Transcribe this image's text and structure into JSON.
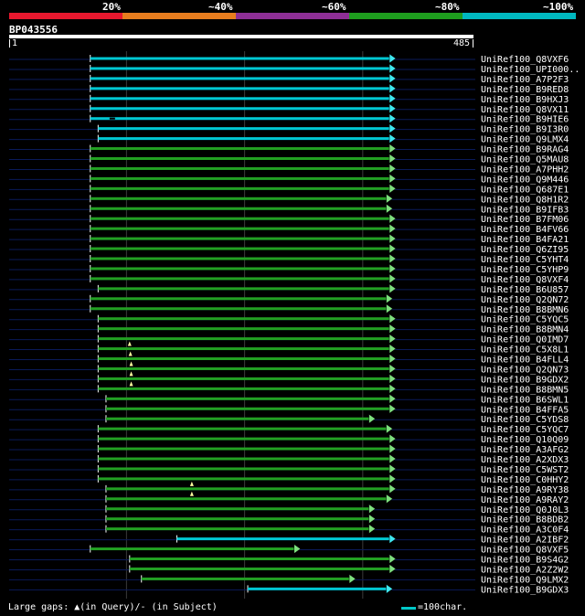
{
  "identity_legend": [
    {
      "label": "20%",
      "color": "#e8182e"
    },
    {
      "label": "~40%",
      "color": "#e87d1e"
    },
    {
      "label": "~60%",
      "color": "#8e2f96"
    },
    {
      "label": "~80%",
      "color": "#1e9e1e"
    },
    {
      "label": "~100%",
      "color": "#00b8c0"
    }
  ],
  "query": {
    "name": "BP043556",
    "start": "1",
    "end": "485",
    "length": 485
  },
  "colors": {
    "cyan": "#00c8d2",
    "green": "#22a022",
    "arrow_green": "#7ee07e",
    "arrow_cyan": "#3fe8f0",
    "gridline": "#3a3a3a",
    "rowline": "#0a1a5a"
  },
  "footer": {
    "gaps_text": "Large gaps: ▲(in Query)/- (in Subject)",
    "scale_text": "=100char."
  },
  "chart_data": {
    "type": "alignment-overview",
    "x_unit": "query residue position",
    "xlim": [
      1,
      485
    ],
    "gridlines_at": [
      150,
      300,
      450
    ],
    "hits": [
      {
        "name": "UniRef100_Q8VXF6",
        "start": 104,
        "end": 485,
        "identity": "~100%"
      },
      {
        "name": "UniRef100_UPI000..",
        "start": 104,
        "end": 485,
        "identity": "~100%"
      },
      {
        "name": "UniRef100_A7P2F3",
        "start": 104,
        "end": 485,
        "identity": "~100%"
      },
      {
        "name": "UniRef100_B9RED8",
        "start": 104,
        "end": 485,
        "identity": "~100%"
      },
      {
        "name": "UniRef100_B9HXJ3",
        "start": 104,
        "end": 485,
        "identity": "~100%"
      },
      {
        "name": "UniRef100_Q8VX11",
        "start": 104,
        "end": 485,
        "identity": "~100%"
      },
      {
        "name": "UniRef100_B9HIE6",
        "start": 104,
        "end": 485,
        "identity": "~100%",
        "subject_gap_at": 132
      },
      {
        "name": "UniRef100_B9I3R0",
        "start": 114,
        "end": 485,
        "identity": "~100%"
      },
      {
        "name": "UniRef100_Q9LMX4",
        "start": 114,
        "end": 485,
        "identity": "~100%"
      },
      {
        "name": "UniRef100_B9RAG4",
        "start": 104,
        "end": 485,
        "identity": "~80%"
      },
      {
        "name": "UniRef100_Q5MAU8",
        "start": 104,
        "end": 485,
        "identity": "~80%"
      },
      {
        "name": "UniRef100_A7PHH2",
        "start": 104,
        "end": 485,
        "identity": "~80%"
      },
      {
        "name": "UniRef100_Q9M446",
        "start": 104,
        "end": 485,
        "identity": "~80%"
      },
      {
        "name": "UniRef100_Q687E1",
        "start": 104,
        "end": 485,
        "identity": "~80%"
      },
      {
        "name": "UniRef100_Q8H1R2",
        "start": 104,
        "end": 481,
        "identity": "~80%"
      },
      {
        "name": "UniRef100_B9IFB3",
        "start": 104,
        "end": 481,
        "identity": "~80%"
      },
      {
        "name": "UniRef100_B7FM06",
        "start": 104,
        "end": 485,
        "identity": "~80%"
      },
      {
        "name": "UniRef100_B4FV66",
        "start": 104,
        "end": 485,
        "identity": "~80%"
      },
      {
        "name": "UniRef100_B4FA21",
        "start": 104,
        "end": 485,
        "identity": "~80%"
      },
      {
        "name": "UniRef100_Q6ZI95",
        "start": 104,
        "end": 485,
        "identity": "~80%"
      },
      {
        "name": "UniRef100_C5YHT4",
        "start": 104,
        "end": 485,
        "identity": "~80%"
      },
      {
        "name": "UniRef100_C5YHP9",
        "start": 104,
        "end": 485,
        "identity": "~80%"
      },
      {
        "name": "UniRef100_Q8VXF4",
        "start": 104,
        "end": 485,
        "identity": "~80%"
      },
      {
        "name": "UniRef100_B6U857",
        "start": 114,
        "end": 485,
        "identity": "~80%"
      },
      {
        "name": "UniRef100_Q2QN72",
        "start": 104,
        "end": 481,
        "identity": "~80%"
      },
      {
        "name": "UniRef100_B8BMN6",
        "start": 104,
        "end": 481,
        "identity": "~80%"
      },
      {
        "name": "UniRef100_C5YQC5",
        "start": 114,
        "end": 485,
        "identity": "~80%"
      },
      {
        "name": "UniRef100_B8BMN4",
        "start": 114,
        "end": 485,
        "identity": "~80%"
      },
      {
        "name": "UniRef100_Q0IMD7",
        "start": 114,
        "end": 485,
        "identity": "~80%"
      },
      {
        "name": "UniRef100_C5X8L1",
        "start": 114,
        "end": 485,
        "identity": "~80%",
        "query_gap_at": 154
      },
      {
        "name": "UniRef100_B4FLL4",
        "start": 114,
        "end": 485,
        "identity": "~80%",
        "query_gap_at": 155
      },
      {
        "name": "UniRef100_Q2QN73",
        "start": 114,
        "end": 485,
        "identity": "~80%",
        "query_gap_at": 156
      },
      {
        "name": "UniRef100_B9GDX2",
        "start": 114,
        "end": 485,
        "identity": "~80%",
        "query_gap_at": 156
      },
      {
        "name": "UniRef100_B8BMN5",
        "start": 114,
        "end": 485,
        "identity": "~80%",
        "query_gap_at": 156
      },
      {
        "name": "UniRef100_B6SWL1",
        "start": 124,
        "end": 485,
        "identity": "~80%"
      },
      {
        "name": "UniRef100_B4FFA5",
        "start": 124,
        "end": 485,
        "identity": "~80%"
      },
      {
        "name": "UniRef100_C5YDS8",
        "start": 124,
        "end": 459,
        "identity": "~80%"
      },
      {
        "name": "UniRef100_C5YQC7",
        "start": 114,
        "end": 481,
        "identity": "~80%"
      },
      {
        "name": "UniRef100_Q10Q09",
        "start": 114,
        "end": 485,
        "identity": "~80%"
      },
      {
        "name": "UniRef100_A3AFG2",
        "start": 114,
        "end": 485,
        "identity": "~80%"
      },
      {
        "name": "UniRef100_A2XDX3",
        "start": 114,
        "end": 485,
        "identity": "~80%"
      },
      {
        "name": "UniRef100_C5WST2",
        "start": 114,
        "end": 485,
        "identity": "~80%"
      },
      {
        "name": "UniRef100_C0HHY2",
        "start": 114,
        "end": 485,
        "identity": "~80%"
      },
      {
        "name": "UniRef100_A9RY38",
        "start": 124,
        "end": 485,
        "identity": "~80%",
        "query_gap_at": 233
      },
      {
        "name": "UniRef100_A9RAY2",
        "start": 124,
        "end": 481,
        "identity": "~80%",
        "query_gap_at": 233
      },
      {
        "name": "UniRef100_Q0J0L3",
        "start": 124,
        "end": 459,
        "identity": "~80%"
      },
      {
        "name": "UniRef100_B8BDB2",
        "start": 124,
        "end": 459,
        "identity": "~80%"
      },
      {
        "name": "UniRef100_A3C0F4",
        "start": 124,
        "end": 459,
        "identity": "~80%"
      },
      {
        "name": "UniRef100_A2IBF2",
        "start": 214,
        "end": 485,
        "identity": "~100%"
      },
      {
        "name": "UniRef100_Q8VXF5",
        "start": 104,
        "end": 364,
        "identity": "~80%"
      },
      {
        "name": "UniRef100_B9S4G2",
        "start": 154,
        "end": 485,
        "identity": "~80%"
      },
      {
        "name": "UniRef100_A2Z2W2",
        "start": 154,
        "end": 485,
        "identity": "~80%"
      },
      {
        "name": "UniRef100_Q9LMX2",
        "start": 169,
        "end": 434,
        "identity": "~80%"
      },
      {
        "name": "UniRef100_B9GDX3",
        "start": 304,
        "end": 481,
        "identity": "~100%"
      }
    ]
  }
}
